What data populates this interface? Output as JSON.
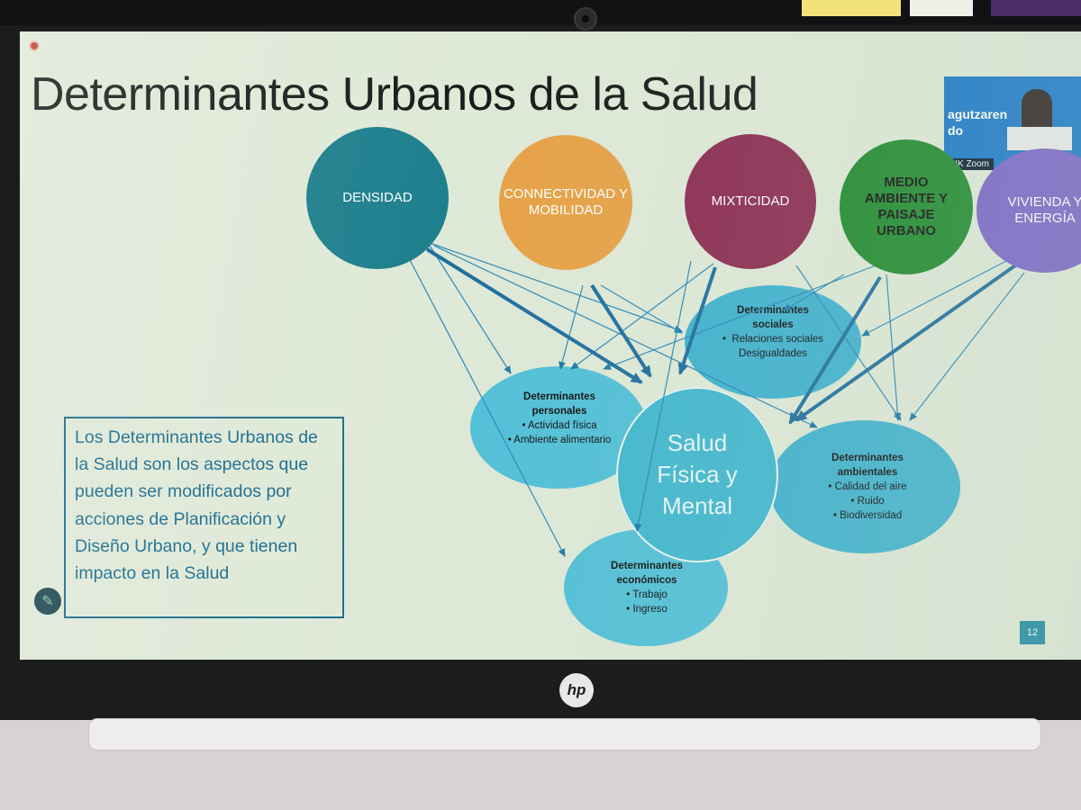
{
  "slide": {
    "title": "Determinantes Urbanos de la Salud",
    "page_number": "12"
  },
  "zoom_overlay": {
    "banner_line1": "agutzaren",
    "banner_line2": "do",
    "label": "UIK Zoom"
  },
  "determinants": [
    {
      "label": "DENSIDAD",
      "color": "#1d7f8c"
    },
    {
      "label": "CONNECTIVIDAD Y MOBILIDAD",
      "color": "#e7a247"
    },
    {
      "label": "MIXTICIDAD",
      "color": "#8d2b52"
    },
    {
      "label": "MEDIO AMBIENTE Y PAISAJE URBANO",
      "color": "#1f8a2e"
    },
    {
      "label": "VIVIENDA Y ENERGÍA",
      "color": "#7a64c8"
    }
  ],
  "center": {
    "line1": "Salud",
    "line2": "Física y",
    "line3": "Mental",
    "color": "#41b7cf"
  },
  "sub_determinants": {
    "sociales": {
      "title": "Determinantes sociales",
      "items": [
        "Relaciones sociales",
        "Desigualdades"
      ]
    },
    "personales": {
      "title": "Determinantes personales",
      "items": [
        "Actividad física",
        "Ambiente alimentario"
      ]
    },
    "ambientales": {
      "title": "Determinantes ambientales",
      "items": [
        "Calidad del aire",
        "Ruido",
        "Biodiversidad"
      ]
    },
    "economicos": {
      "title": "Determinantes económicos",
      "items": [
        "Trabajo",
        "Ingreso"
      ]
    }
  },
  "definition_text": "Los Determinantes Urbanos de la Salud son los aspectos que pueden ser modificados por acciones de Planificación y Diseño Urbano, y que tienen impacto en la Salud",
  "laptop": {
    "brand": "hp"
  }
}
